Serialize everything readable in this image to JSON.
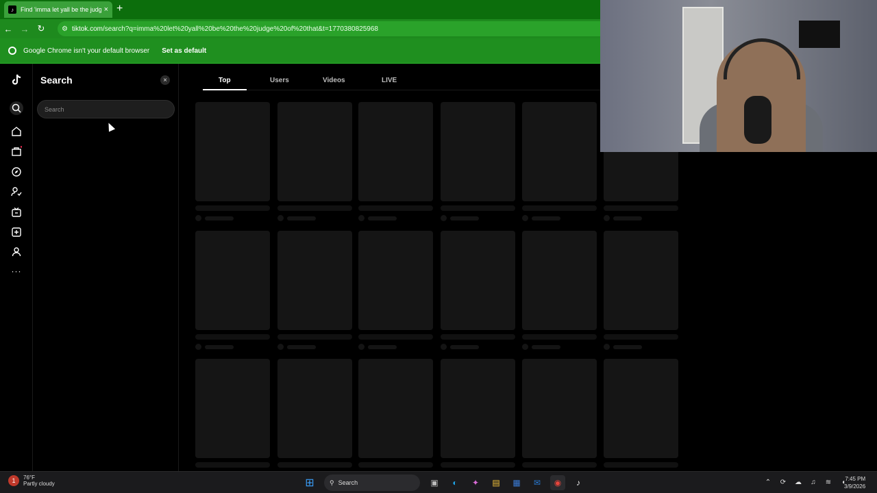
{
  "browser": {
    "tab_title": "Find 'imma let yall be the judge",
    "tab_close": "×",
    "new_tab": "+",
    "url_domain": "tiktok.com",
    "url_path": "/search?q=imma%20let%20yall%20be%20the%20judge%20of%20that&t=1770380825968",
    "infobar_text": "Google Chrome isn't your default browser",
    "infobar_button": "Set as default"
  },
  "search_panel": {
    "title": "Search",
    "close": "×",
    "placeholder": "Search"
  },
  "tabs": [
    {
      "label": "Top",
      "active": true
    },
    {
      "label": "Users",
      "active": false
    },
    {
      "label": "Videos",
      "active": false
    },
    {
      "label": "LIVE",
      "active": false
    }
  ],
  "rail_icons": [
    "tiktok-logo-icon",
    "search-icon",
    "home-icon",
    "shop-icon",
    "explore-icon",
    "following-icon",
    "live-icon",
    "upload-icon",
    "profile-icon",
    "more-icon"
  ],
  "taskbar": {
    "weather_temp": "76°F",
    "weather_desc": "Partly cloudy",
    "weather_badge": "1",
    "search_label": "Search",
    "time": "7:45 PM",
    "date": "3/9/2026"
  },
  "colors": {
    "chrome_green": "#1e8a1e",
    "tiktok_bg": "#000000",
    "skeleton": "#151515"
  }
}
